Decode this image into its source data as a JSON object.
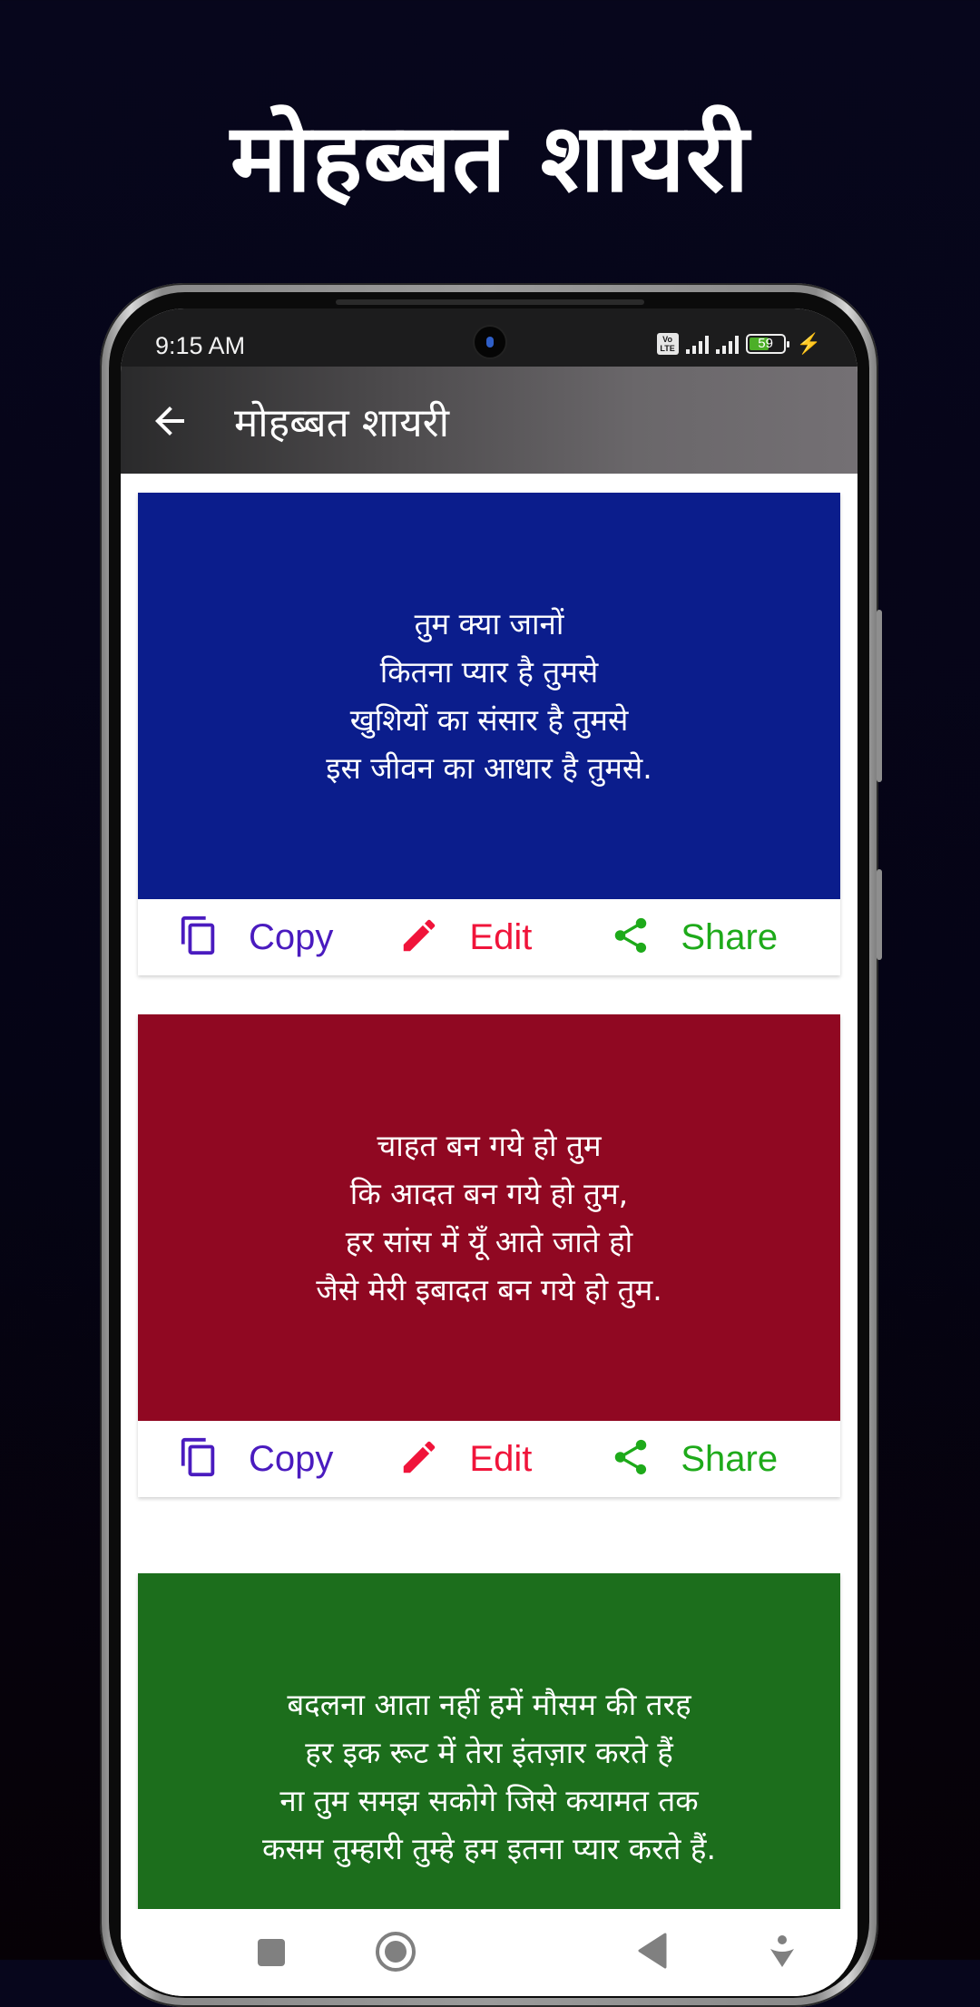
{
  "promo": {
    "title": "मोहब्बत शायरी"
  },
  "status_bar": {
    "time": "9:15 AM",
    "volte_top": "Vo",
    "volte_bottom": "LTE",
    "battery_level": 59,
    "battery_text": "59",
    "charging": true
  },
  "app_bar": {
    "title": "मोहब्बत शायरी",
    "back_icon": "arrow-left-icon"
  },
  "actions": {
    "copy": "Copy",
    "edit": "Edit",
    "share": "Share"
  },
  "colors": {
    "copy": "#4a1bbf",
    "edit": "#f0143a",
    "share": "#1eaa1a"
  },
  "cards": [
    {
      "bg": "#0b1d8c",
      "text": "तुम क्या जानों\nकितना प्यार है तुमसे\nखुशियों का संसार है तुमसे\nइस जीवन का आधार है तुमसे."
    },
    {
      "bg": "#900822",
      "text": "चाहत बन गये हो तुम\nकि आदत बन गये हो तुम,\nहर सांस में यूँ आते जाते हो\nजैसे मेरी इबादत बन गये हो तुम."
    },
    {
      "bg": "#1c6e1c",
      "text": "बदलना आता नहीं हमें मौसम की तरह\nहर इक रूट में तेरा इंतज़ार करते हैं\nना तुम समझ सकोगे जिसे कयामत तक\nकसम तुम्हारी तुम्हे हम इतना प्यार करते हैं."
    }
  ],
  "nav_bar": {
    "items": [
      "recents-square-icon",
      "home-circle-icon",
      "back-triangle-icon",
      "assistant-icon"
    ]
  }
}
